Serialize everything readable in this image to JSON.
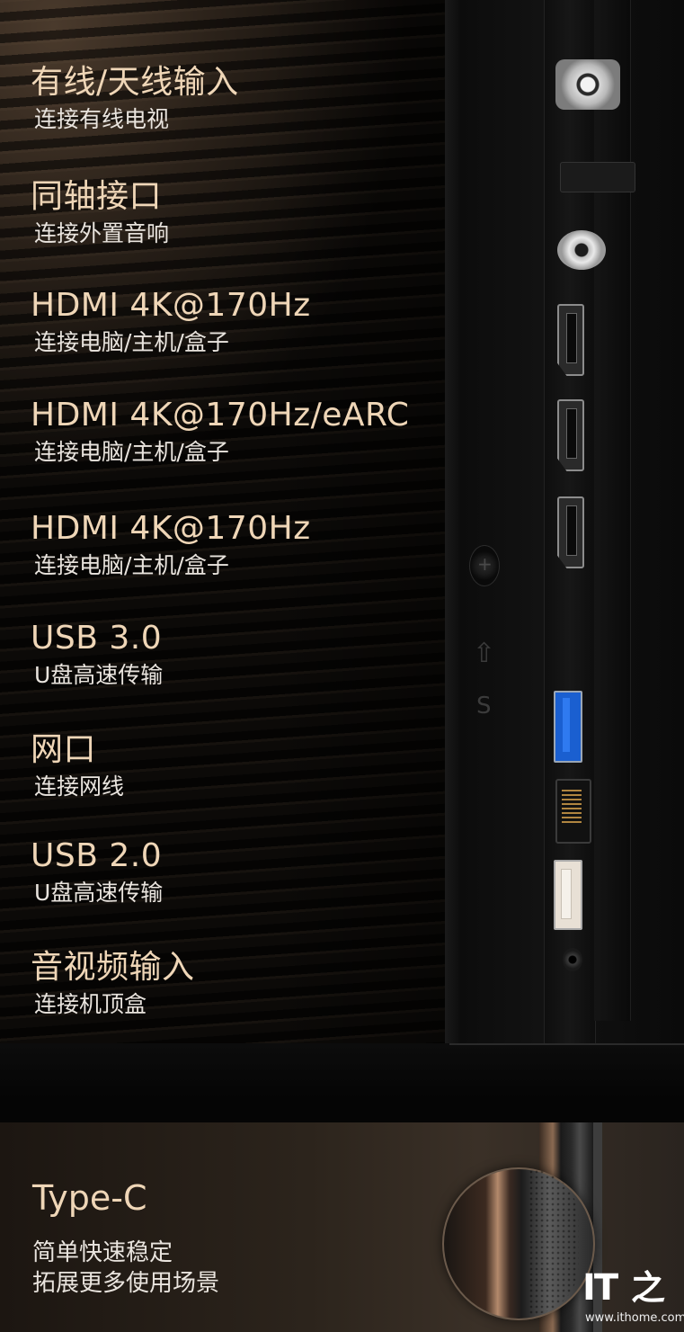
{
  "ports": [
    {
      "title": "有线/天线输入",
      "subtitle": "连接有线电视"
    },
    {
      "title": "同轴接口",
      "subtitle": "连接外置音响"
    },
    {
      "title": "HDMI 4K@170Hz",
      "subtitle": "连接电脑/主机/盒子"
    },
    {
      "title": "HDMI 4K@170Hz/eARC",
      "subtitle": "连接电脑/主机/盒子"
    },
    {
      "title": "HDMI 4K@170Hz",
      "subtitle": "连接电脑/主机/盒子"
    },
    {
      "title": "USB 3.0",
      "subtitle": "U盘高速传输"
    },
    {
      "title": "网口",
      "subtitle": "连接网线"
    },
    {
      "title": "USB 2.0",
      "subtitle": "U盘高速传输"
    },
    {
      "title": "音视频输入",
      "subtitle": "连接机顶盒"
    }
  ],
  "typec": {
    "title": "Type-C",
    "line1": "简单快速稳定",
    "line2": "拓展更多使用场景"
  },
  "chassis_marks": {
    "screw": "+",
    "arrow": "⇧",
    "letter": "S"
  },
  "watermark": {
    "logo_latin": "IT",
    "logo_char": "之",
    "url": "www.ithome.com"
  }
}
